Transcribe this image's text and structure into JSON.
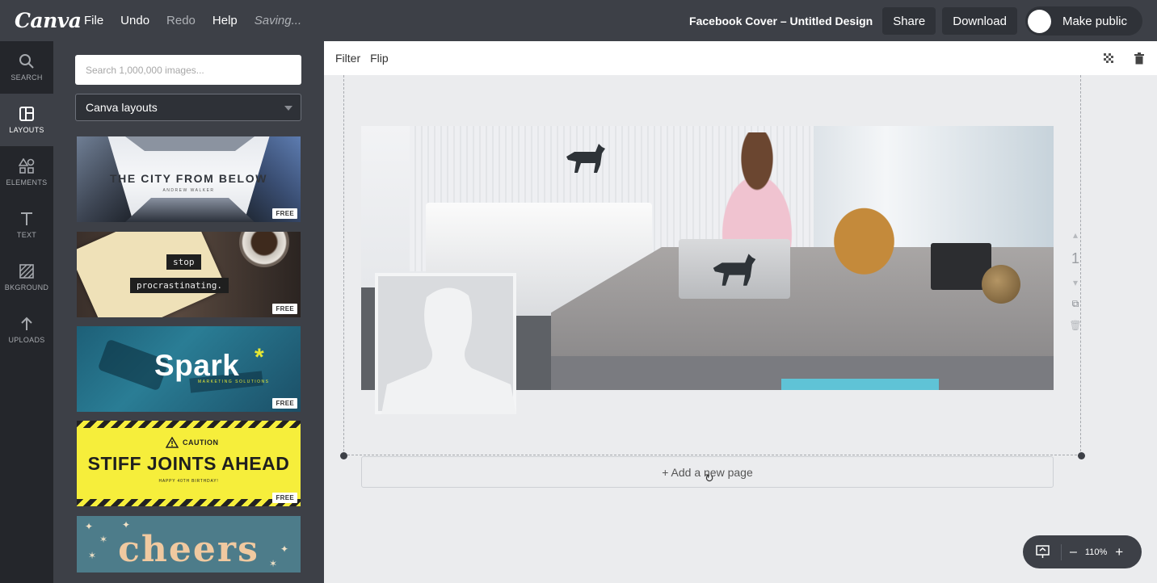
{
  "app": {
    "logo": "Canva",
    "menu": [
      "File",
      "Undo",
      "Redo",
      "Help"
    ],
    "status": "Saving...",
    "doc_title": "Facebook Cover – Untitled Design",
    "share_label": "Share",
    "download_label": "Download",
    "public_label": "Make public"
  },
  "rail": {
    "items": [
      {
        "label": "SEARCH",
        "icon": "search-icon"
      },
      {
        "label": "LAYOUTS",
        "icon": "layouts-icon"
      },
      {
        "label": "ELEMENTS",
        "icon": "elements-icon"
      },
      {
        "label": "TEXT",
        "icon": "text-icon"
      },
      {
        "label": "BKGROUND",
        "icon": "background-icon"
      },
      {
        "label": "UPLOADS",
        "icon": "upload-icon"
      }
    ],
    "active": "LAYOUTS"
  },
  "panel": {
    "search_placeholder": "Search 1,000,000 images...",
    "dropdown_value": "Canva layouts",
    "templates": [
      {
        "title": "THE CITY FROM BELOW",
        "subtitle": "ANDREW WALKER",
        "badge": "FREE"
      },
      {
        "line1": "stop",
        "line2": "procrastinating.",
        "badge": "FREE"
      },
      {
        "brand": "Spark",
        "mark": "*",
        "sub": "MARKETING SOLUTIONS",
        "badge": "FREE"
      },
      {
        "warning": "CAUTION",
        "headline": "STIFF JOINTS AHEAD",
        "sub": "HAPPY 40TH BIRTHDAY!",
        "badge": "FREE"
      },
      {
        "word": "cheers"
      }
    ]
  },
  "editor": {
    "toolbar": {
      "filter_label": "Filter",
      "flip_label": "Flip"
    },
    "add_page_label": "+ Add a new page",
    "side_tools": {
      "page_number": "1"
    },
    "zoom": "110%"
  },
  "colors": {
    "topbar": "#3d4047",
    "rail": "#24262b",
    "canvas": "#ebecee"
  }
}
